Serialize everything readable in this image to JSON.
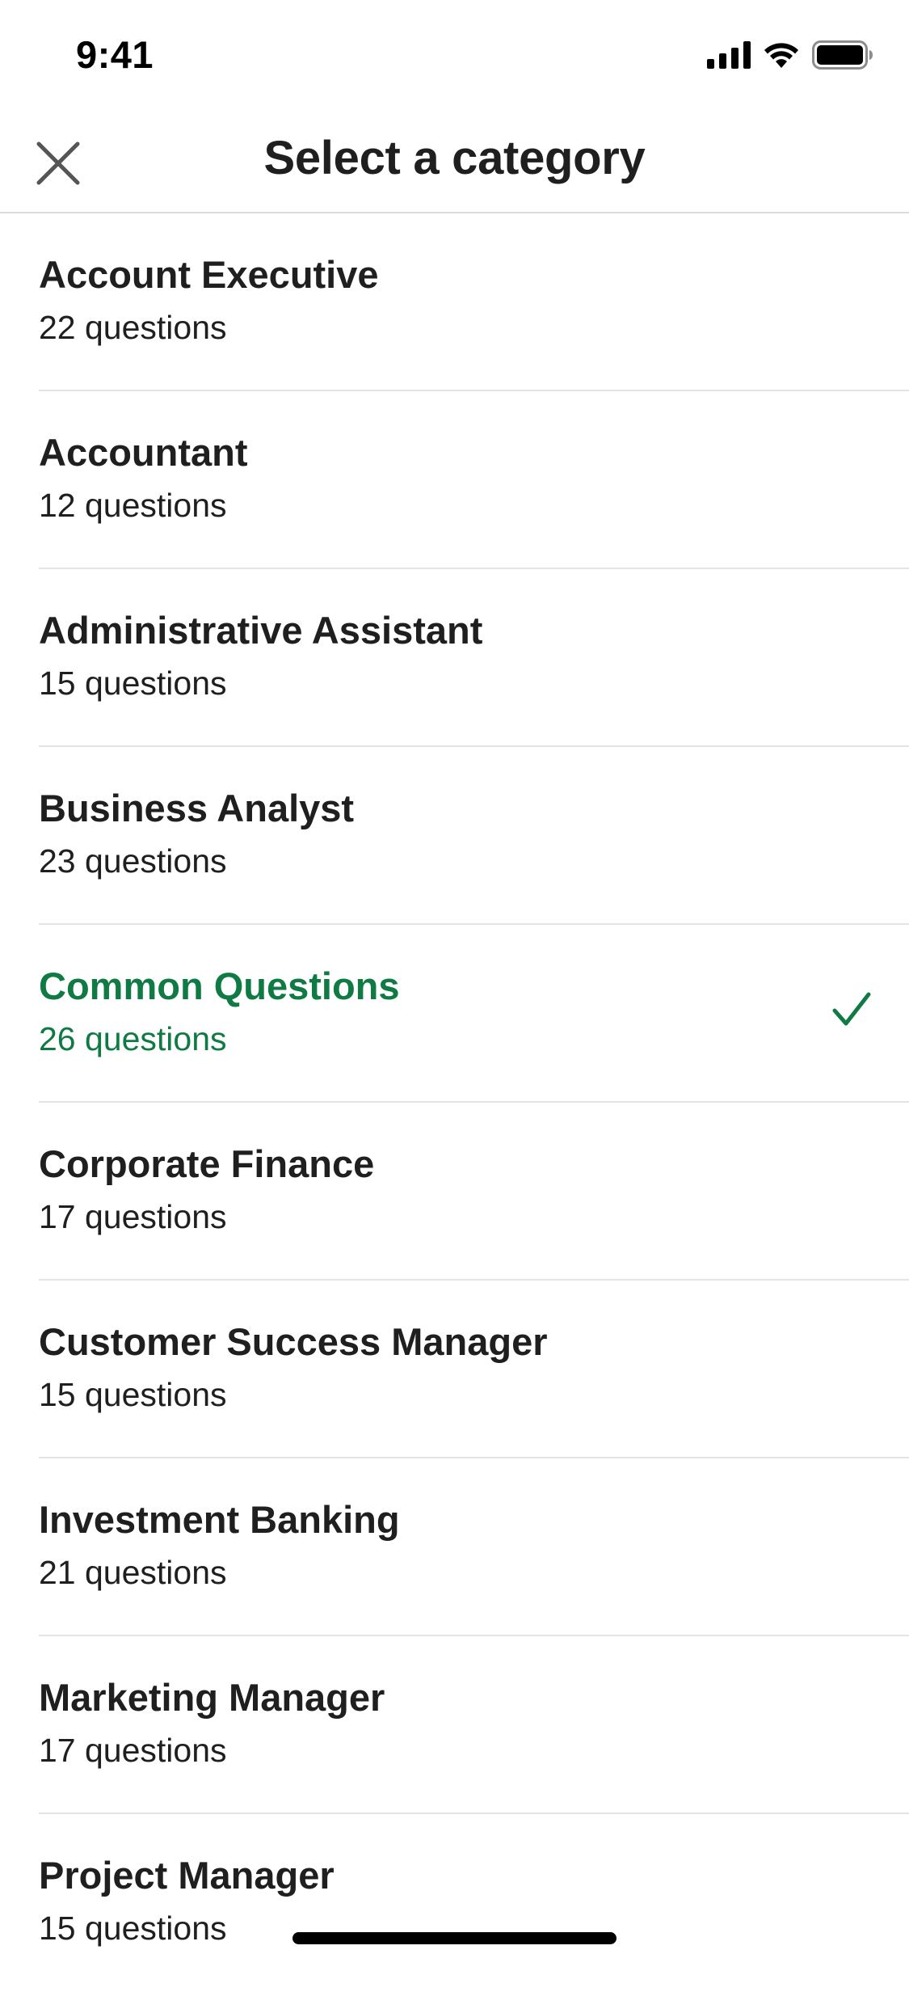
{
  "status_bar": {
    "time": "9:41",
    "icons": [
      "signal-icon",
      "wifi-icon",
      "battery-icon"
    ]
  },
  "header": {
    "title": "Select a category",
    "close_icon": "close-icon"
  },
  "colors": {
    "selected": "#0f7a44",
    "text": "#1f1f1f",
    "divider": "#e4e4e4"
  },
  "categories": [
    {
      "title": "Account Executive",
      "count": "22 questions",
      "selected": false
    },
    {
      "title": "Accountant",
      "count": "12 questions",
      "selected": false
    },
    {
      "title": "Administrative Assistant",
      "count": "15 questions",
      "selected": false
    },
    {
      "title": "Business Analyst",
      "count": "23 questions",
      "selected": false
    },
    {
      "title": "Common Questions",
      "count": "26 questions",
      "selected": true
    },
    {
      "title": "Corporate Finance",
      "count": "17 questions",
      "selected": false
    },
    {
      "title": "Customer Success Manager",
      "count": "15 questions",
      "selected": false
    },
    {
      "title": "Investment Banking",
      "count": "21 questions",
      "selected": false
    },
    {
      "title": "Marketing Manager",
      "count": "17 questions",
      "selected": false
    },
    {
      "title": "Project Manager",
      "count": "15 questions",
      "selected": false
    }
  ]
}
